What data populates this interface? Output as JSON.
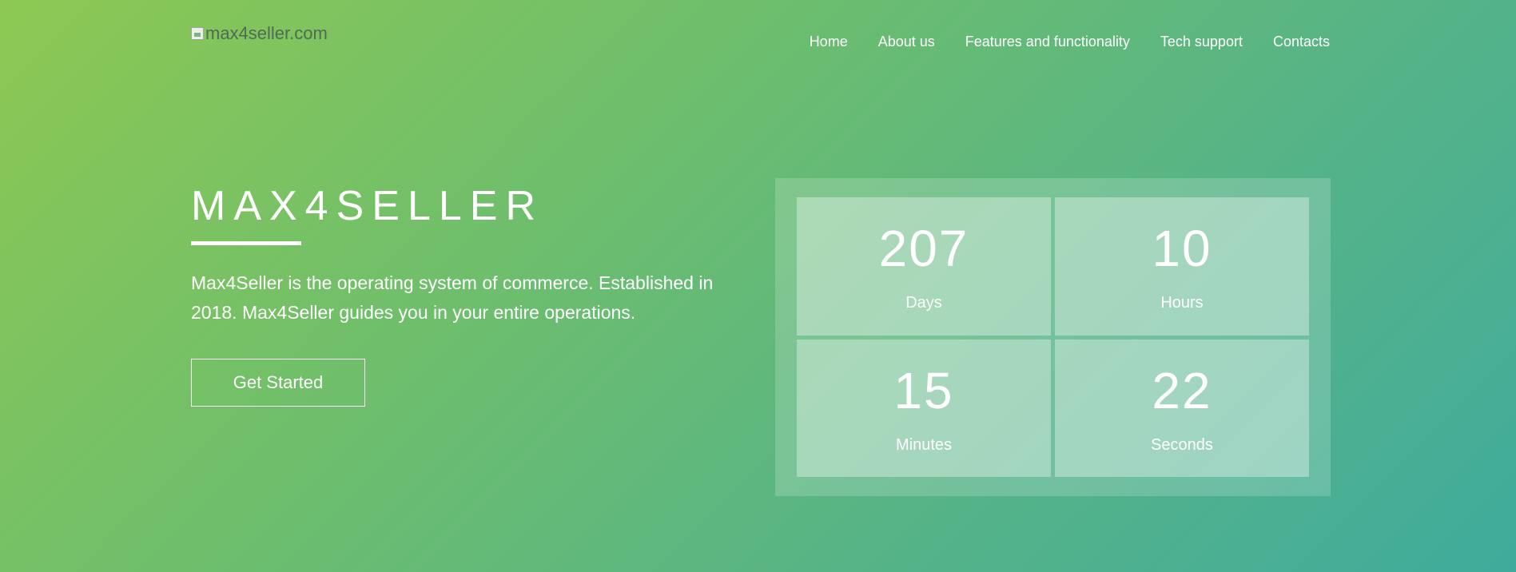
{
  "header": {
    "logo_alt": "max4seller.com",
    "nav": [
      {
        "label": "Home"
      },
      {
        "label": "About us"
      },
      {
        "label": "Features and functionality"
      },
      {
        "label": "Tech support"
      },
      {
        "label": "Contacts"
      }
    ]
  },
  "hero": {
    "title": "MAX4SELLER",
    "description": "Max4Seller is the operating system of commerce. Established in 2018. Max4Seller guides you in your entire operations.",
    "cta_label": "Get Started"
  },
  "countdown": [
    {
      "value": "207",
      "label": "Days"
    },
    {
      "value": "10",
      "label": "Hours"
    },
    {
      "value": "15",
      "label": "Minutes"
    },
    {
      "value": "22",
      "label": "Seconds"
    }
  ],
  "colors": {
    "gradient_start": "#8dc853",
    "gradient_end": "#40ab9c",
    "text": "#ffffff"
  }
}
